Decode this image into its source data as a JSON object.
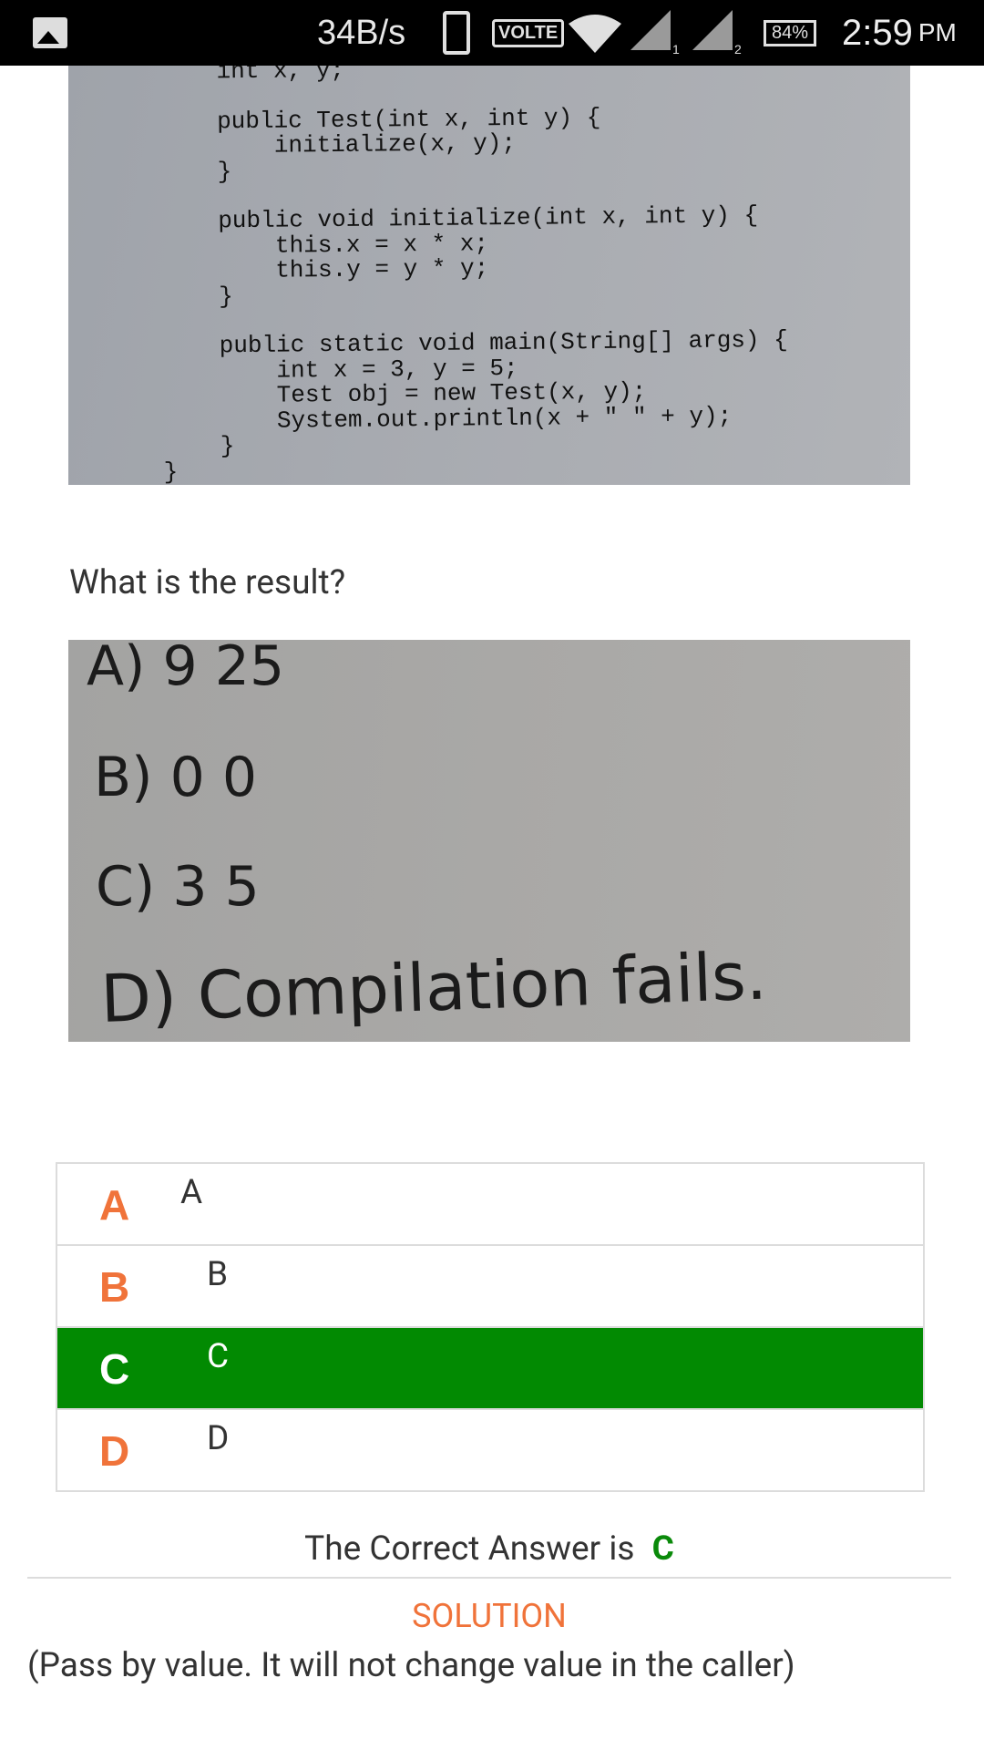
{
  "status_bar": {
    "speed": "34B/s",
    "volte": "VOLTE",
    "sim1": "1",
    "sim2": "2",
    "battery": "84%",
    "time": "2:59",
    "ampm": "PM",
    "icons": [
      "gallery-icon",
      "phone-icon",
      "wifi-icon",
      "signal-icon",
      "signal-icon",
      "battery-icon"
    ]
  },
  "code_image": {
    "lines": [
      "    int x, y;",
      "",
      "    public Test(int x, int y) {",
      "        initialize(x, y);",
      "    }",
      "",
      "    public void initialize(int x, int y) {",
      "        this.x = x * x;",
      "        this.y = y * y;",
      "    }",
      "",
      "    public static void main(String[] args) {",
      "        int x = 3, y = 5;",
      "        Test obj = new Test(x, y);",
      "        System.out.println(x + \" \" + y);",
      "    }",
      "}"
    ]
  },
  "question": "What is the result?",
  "options_image": {
    "a": "A) 9  25",
    "b": "B) 0  0",
    "c": "C) 3  5",
    "d": "D) Compilation fails."
  },
  "choices": [
    {
      "letter": "A",
      "text": "A"
    },
    {
      "letter": "B",
      "text": "B"
    },
    {
      "letter": "C",
      "text": "C"
    },
    {
      "letter": "D",
      "text": "D"
    }
  ],
  "selected_choice": "C",
  "colors": {
    "accent_orange": "#f0733a",
    "correct_green": "#028a02"
  },
  "result": {
    "prefix": "The Correct Answer is",
    "answer": "C"
  },
  "solution": {
    "title": "SOLUTION",
    "text": "(Pass by value. It will not change value in the caller)"
  }
}
